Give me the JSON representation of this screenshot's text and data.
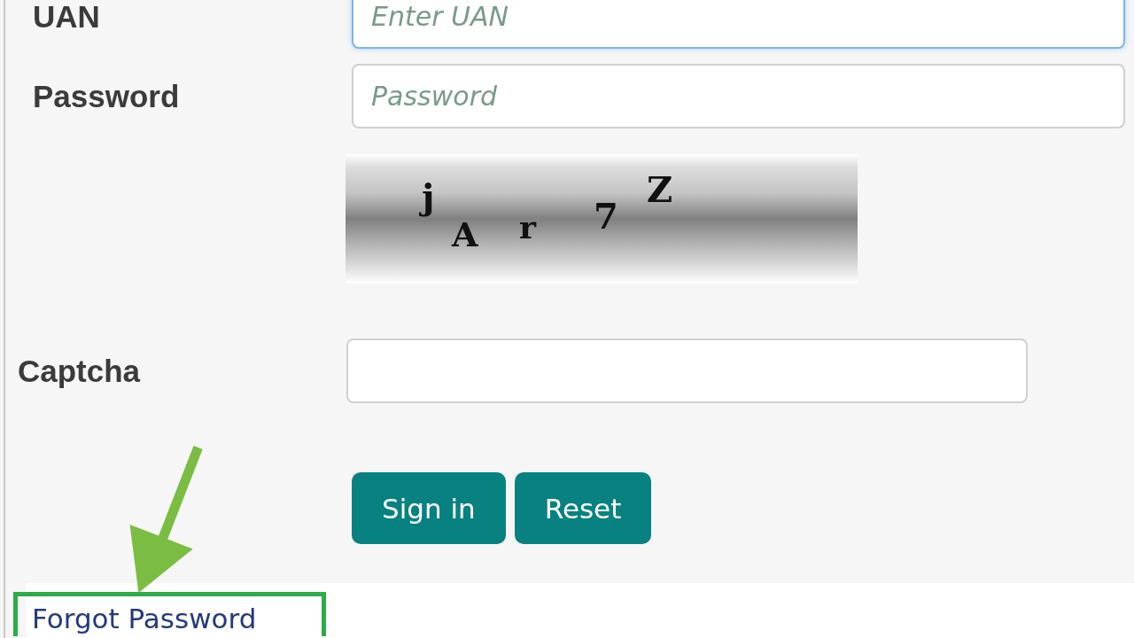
{
  "form": {
    "fields": [
      {
        "label": "UAN",
        "placeholder": "Enter UAN",
        "focused": true
      },
      {
        "label": "Password",
        "placeholder": "Password",
        "focused": false
      }
    ],
    "captcha_image": {
      "characters": [
        "j",
        "A",
        "r",
        "7",
        "Z"
      ]
    },
    "captcha_field": {
      "label": "Captcha"
    },
    "buttons": [
      "Sign in",
      "Reset"
    ],
    "forgot_link": "Forgot Password"
  }
}
